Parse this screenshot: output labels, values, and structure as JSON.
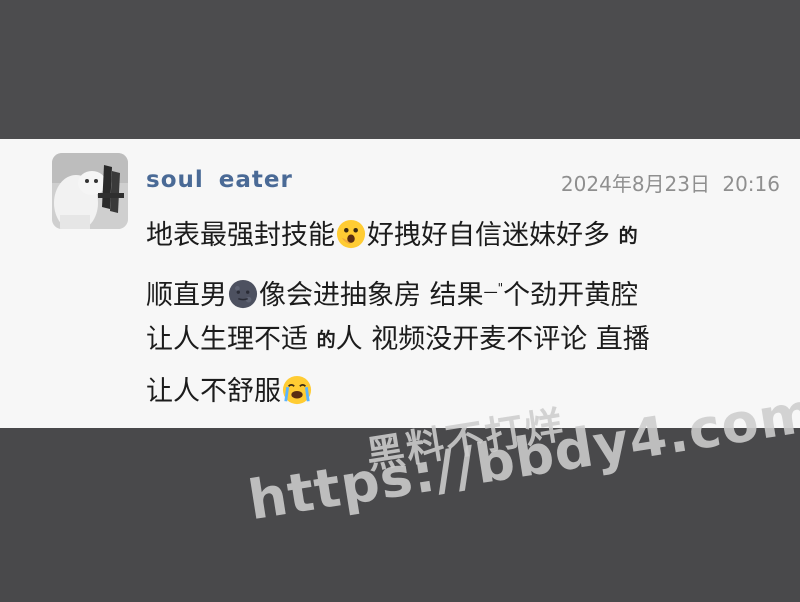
{
  "post": {
    "username": "soul eater",
    "timestamp": "2024年8月23日 20:16",
    "lines": [
      [
        "地表最强封技能",
        "好拽好自信迷妹好多",
        "的"
      ],
      [
        "顺直男",
        "像会进抽象房 结果",
        "个劲开黄腔"
      ],
      [
        "让人生理不适",
        "的",
        "人 视频没开麦不评论 直播"
      ],
      [
        "让人不舒服"
      ]
    ],
    "line2_dash": "一",
    "line2_marks": "\""
  },
  "avatar": {
    "icon": "cat-photo-avatar"
  },
  "emojis": {
    "e1": "face-with-hand-over-mouth-emoji",
    "e2": "new-moon-face-emoji",
    "e3": "loudly-crying-face-emoji"
  },
  "watermark": {
    "line1": "黑料不打烊",
    "line2": "https://bbdy4.com"
  },
  "colors": {
    "background": "#4a4a4c",
    "card": "#f7f7f7",
    "username": "#4a6a96",
    "timestamp": "#8f8f8f",
    "text": "#1c1c1c"
  }
}
